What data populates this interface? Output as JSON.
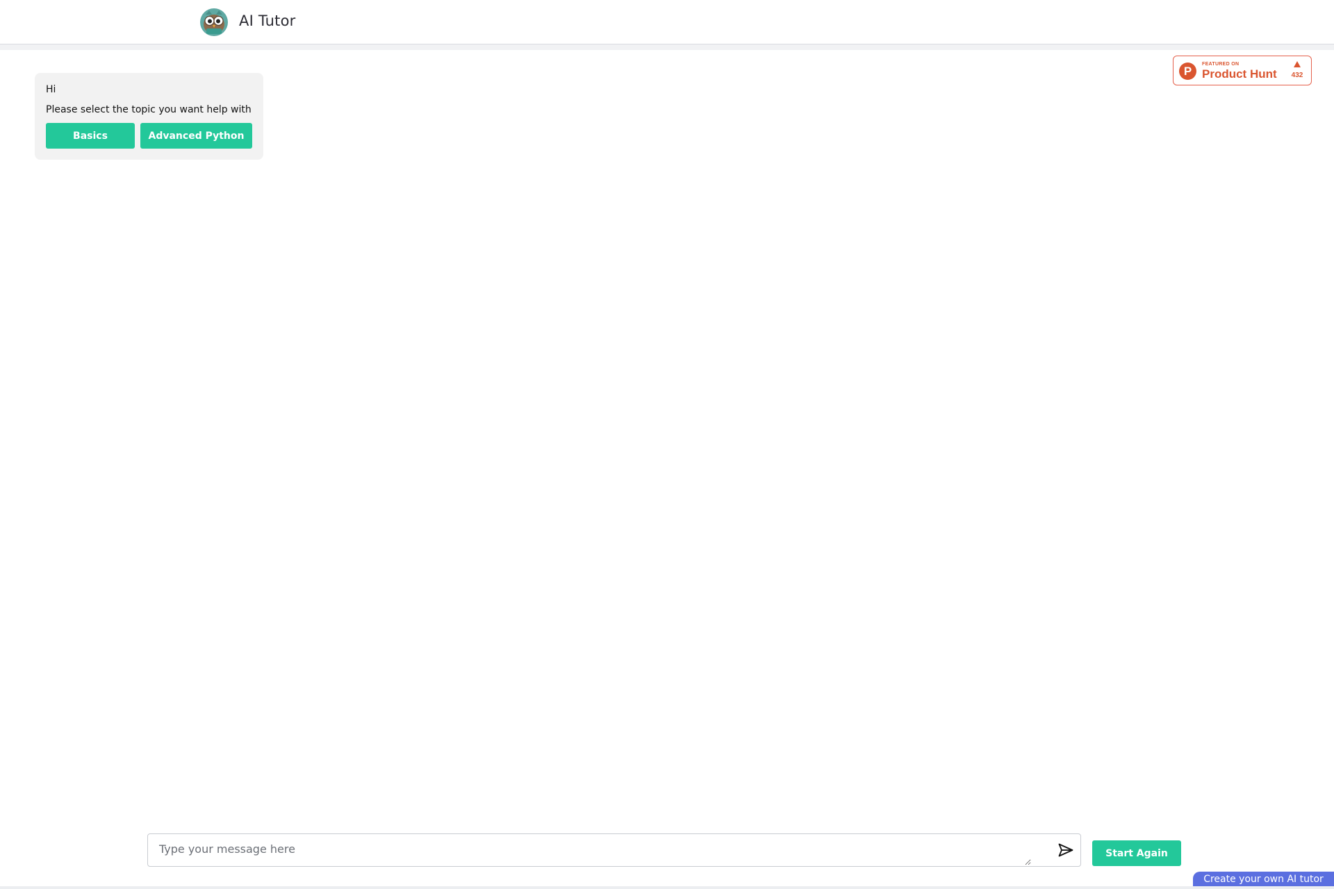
{
  "header": {
    "title": "AI Tutor",
    "logo_icon": "owl-logo-icon"
  },
  "badge": {
    "featured": "FEATURED ON",
    "name": "Product Hunt",
    "letter": "P",
    "upvotes": "432",
    "color": "#da552f"
  },
  "chat": {
    "greeting": "Hi",
    "prompt": "Please select the topic you want help with",
    "topics": [
      {
        "label": "Basics"
      },
      {
        "label": "Advanced Python"
      }
    ]
  },
  "composer": {
    "value": "",
    "placeholder": "Type your message here",
    "send_icon": "send-icon"
  },
  "actions": {
    "start_again": "Start Again",
    "create_tutor": "Create your own AI tutor"
  },
  "colors": {
    "accent": "#23c89a",
    "create_tab": "#5b6fe0"
  }
}
